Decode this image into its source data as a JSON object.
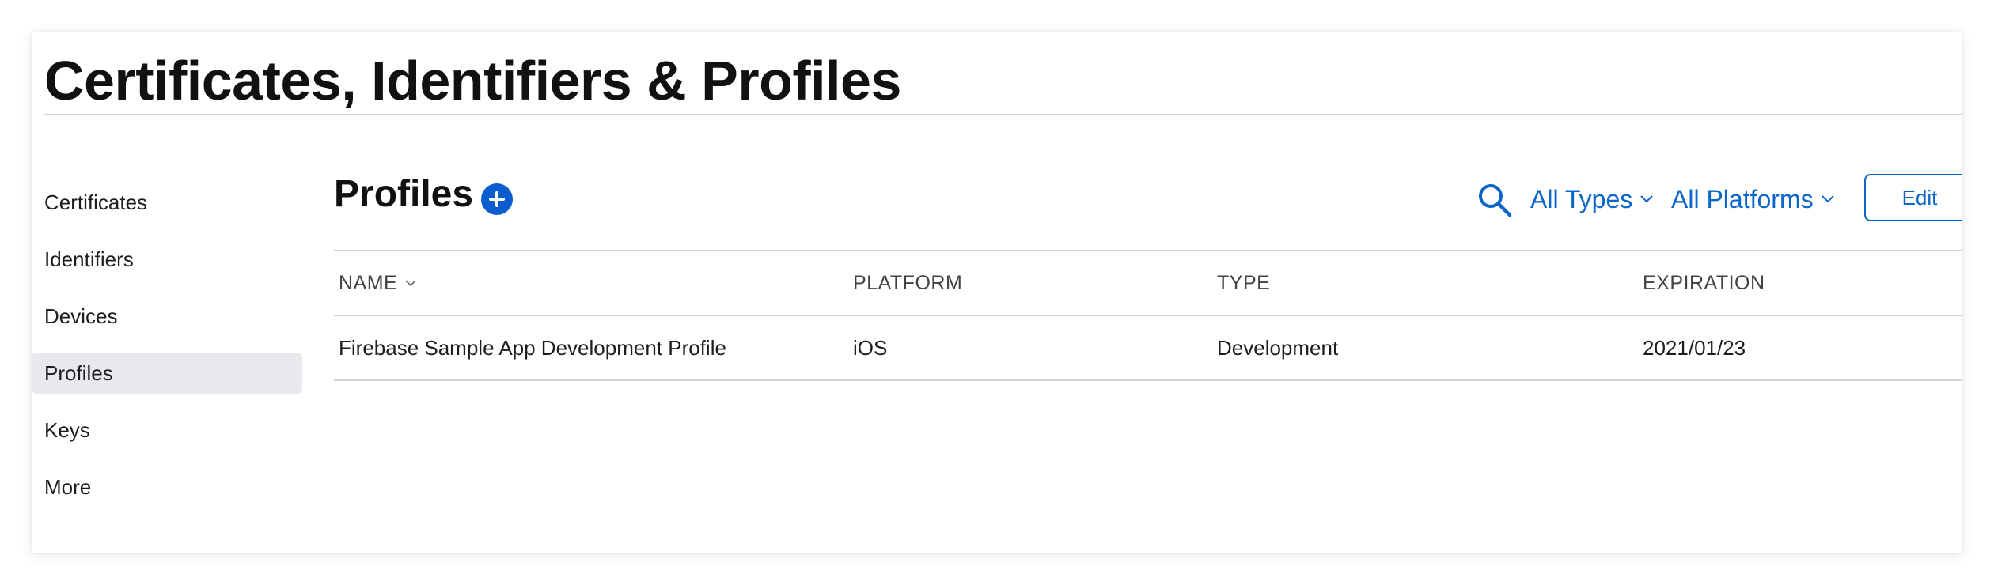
{
  "page": {
    "title": "Certificates, Identifiers & Profiles"
  },
  "sidebar": {
    "items": [
      {
        "label": "Certificates",
        "active": false
      },
      {
        "label": "Identifiers",
        "active": false
      },
      {
        "label": "Devices",
        "active": false
      },
      {
        "label": "Profiles",
        "active": true
      },
      {
        "label": "Keys",
        "active": false
      },
      {
        "label": "More",
        "active": false
      }
    ]
  },
  "section": {
    "title": "Profiles",
    "add_icon": "plus-circle-icon",
    "search_icon": "search-icon",
    "filters": {
      "type_label": "All Types",
      "platform_label": "All Platforms"
    },
    "edit_label": "Edit"
  },
  "table": {
    "columns": [
      "NAME",
      "PLATFORM",
      "TYPE",
      "EXPIRATION"
    ],
    "rows": [
      {
        "name": "Firebase Sample App Development Profile",
        "platform": "iOS",
        "type": "Development",
        "expiration": "2021/01/23"
      }
    ]
  },
  "colors": {
    "accent": "#0a66c9",
    "add_button": "#0a5ccf",
    "active_sidebar_bg": "#e8e8ed",
    "divider": "#d2d2d7"
  }
}
